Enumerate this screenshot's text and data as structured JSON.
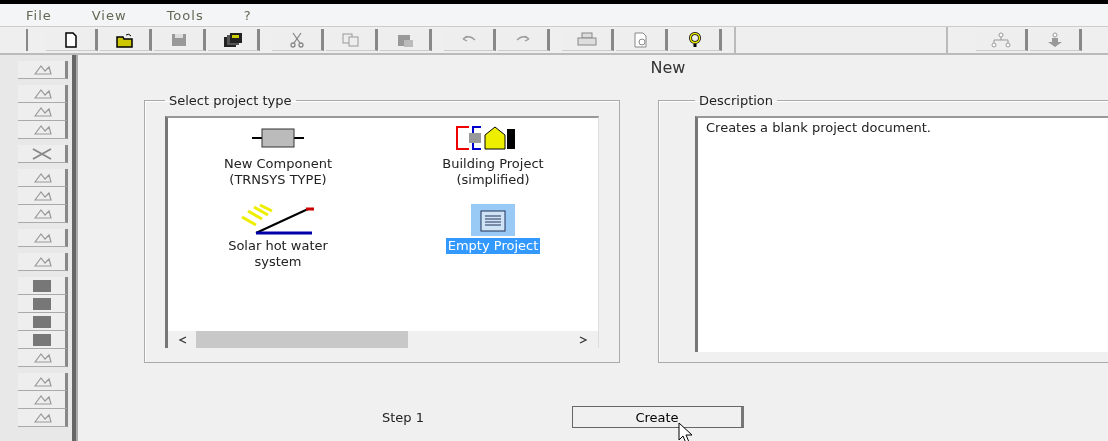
{
  "menu": [
    {
      "label": "File"
    },
    {
      "label": "View"
    },
    {
      "label": "Tools"
    },
    {
      "label": "?"
    }
  ],
  "panel": {
    "title": "New"
  },
  "project_group": {
    "legend": "Select project type",
    "items": [
      {
        "kind": "component",
        "label": "New Component\n(TRNSYS TYPE)",
        "selected": false
      },
      {
        "kind": "building",
        "label": "Building Project\n(simplified)",
        "selected": false
      },
      {
        "kind": "solar",
        "label": "Solar hot water\nsystem",
        "selected": false
      },
      {
        "kind": "empty",
        "label": "Empty Project",
        "selected": true
      }
    ]
  },
  "description_group": {
    "legend": "Description",
    "text": "Creates a blank project document."
  },
  "footer": {
    "step": "Step 1",
    "button": "Create"
  }
}
